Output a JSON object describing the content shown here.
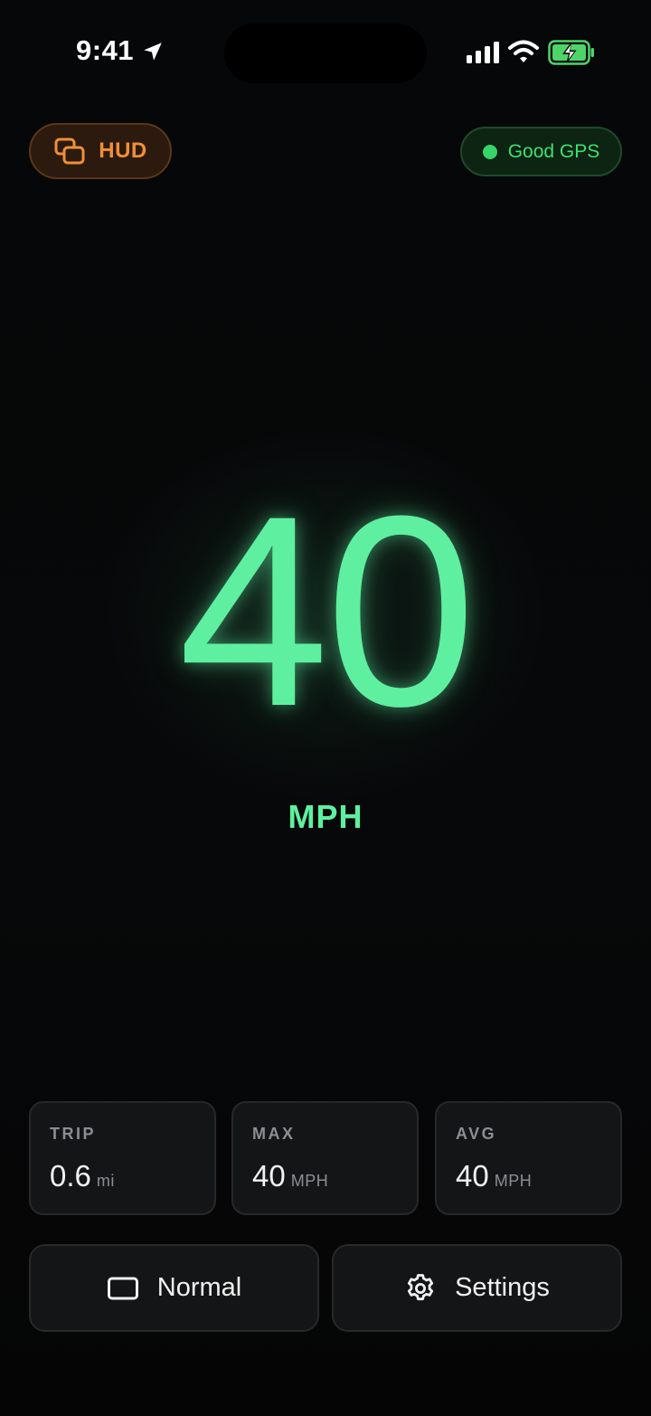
{
  "status_bar": {
    "time": "9:41"
  },
  "hud_button": {
    "label": "HUD",
    "color": "#f08f36"
  },
  "gps_status": {
    "label": "Good GPS",
    "color": "#3ee06f"
  },
  "speed": {
    "value": "40",
    "unit": "MPH",
    "color": "#5ef0a0"
  },
  "stats": {
    "trip": {
      "label": "TRIP",
      "value": "0.6",
      "unit": "mi"
    },
    "max": {
      "label": "MAX",
      "value": "40",
      "unit": "MPH"
    },
    "avg": {
      "label": "AVG",
      "value": "40",
      "unit": "MPH"
    }
  },
  "buttons": {
    "mode": {
      "label": "Normal",
      "icon": "rectangle-icon"
    },
    "settings": {
      "label": "Settings",
      "icon": "gear-icon"
    }
  }
}
